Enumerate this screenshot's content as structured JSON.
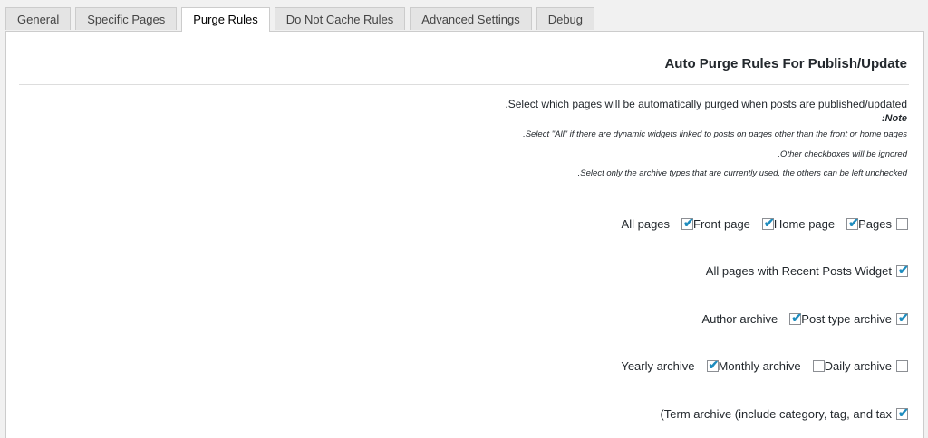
{
  "tabs": [
    {
      "label": "General"
    },
    {
      "label": "Specific Pages"
    },
    {
      "label": "Purge Rules",
      "active": true
    },
    {
      "label": "Do Not Cache Rules"
    },
    {
      "label": "Advanced Settings"
    },
    {
      "label": "Debug"
    }
  ],
  "section": {
    "title": "Auto Purge Rules For Publish/Update",
    "description": ".Select which pages will be automatically purged when posts are published/updated",
    "note_title": ":Note",
    "note_lines": [
      ".Select \"All\" if there are dynamic widgets linked to posts on pages other than the front or home pages",
      ".Other checkboxes will be ignored",
      ".Select only the archive types that are currently used, the others can be left unchecked"
    ]
  },
  "options": {
    "all_pages": {
      "label": "All pages",
      "checked": false
    },
    "front_page": {
      "label": "Front page",
      "checked": true
    },
    "home_page": {
      "label": "Home page",
      "checked": true
    },
    "pages": {
      "label": "Pages",
      "checked": true
    },
    "recent_posts_widget": {
      "label": "All pages with Recent Posts Widget",
      "checked": true
    },
    "post_type_archive": {
      "label": "Post type archive",
      "checked": true
    },
    "author_archive": {
      "label": "Author archive",
      "checked": true
    },
    "daily_archive": {
      "label": "Daily archive",
      "checked": false
    },
    "monthly_archive": {
      "label": "Monthly archive",
      "checked": false
    },
    "yearly_archive": {
      "label": "Yearly archive",
      "checked": true
    },
    "term_archive": {
      "label": "(Term archive (include category, tag, and tax",
      "checked": true
    }
  },
  "colors": {
    "accent_check": "#1e8cbe",
    "background": "#f1f1f1",
    "panel": "#ffffff"
  }
}
